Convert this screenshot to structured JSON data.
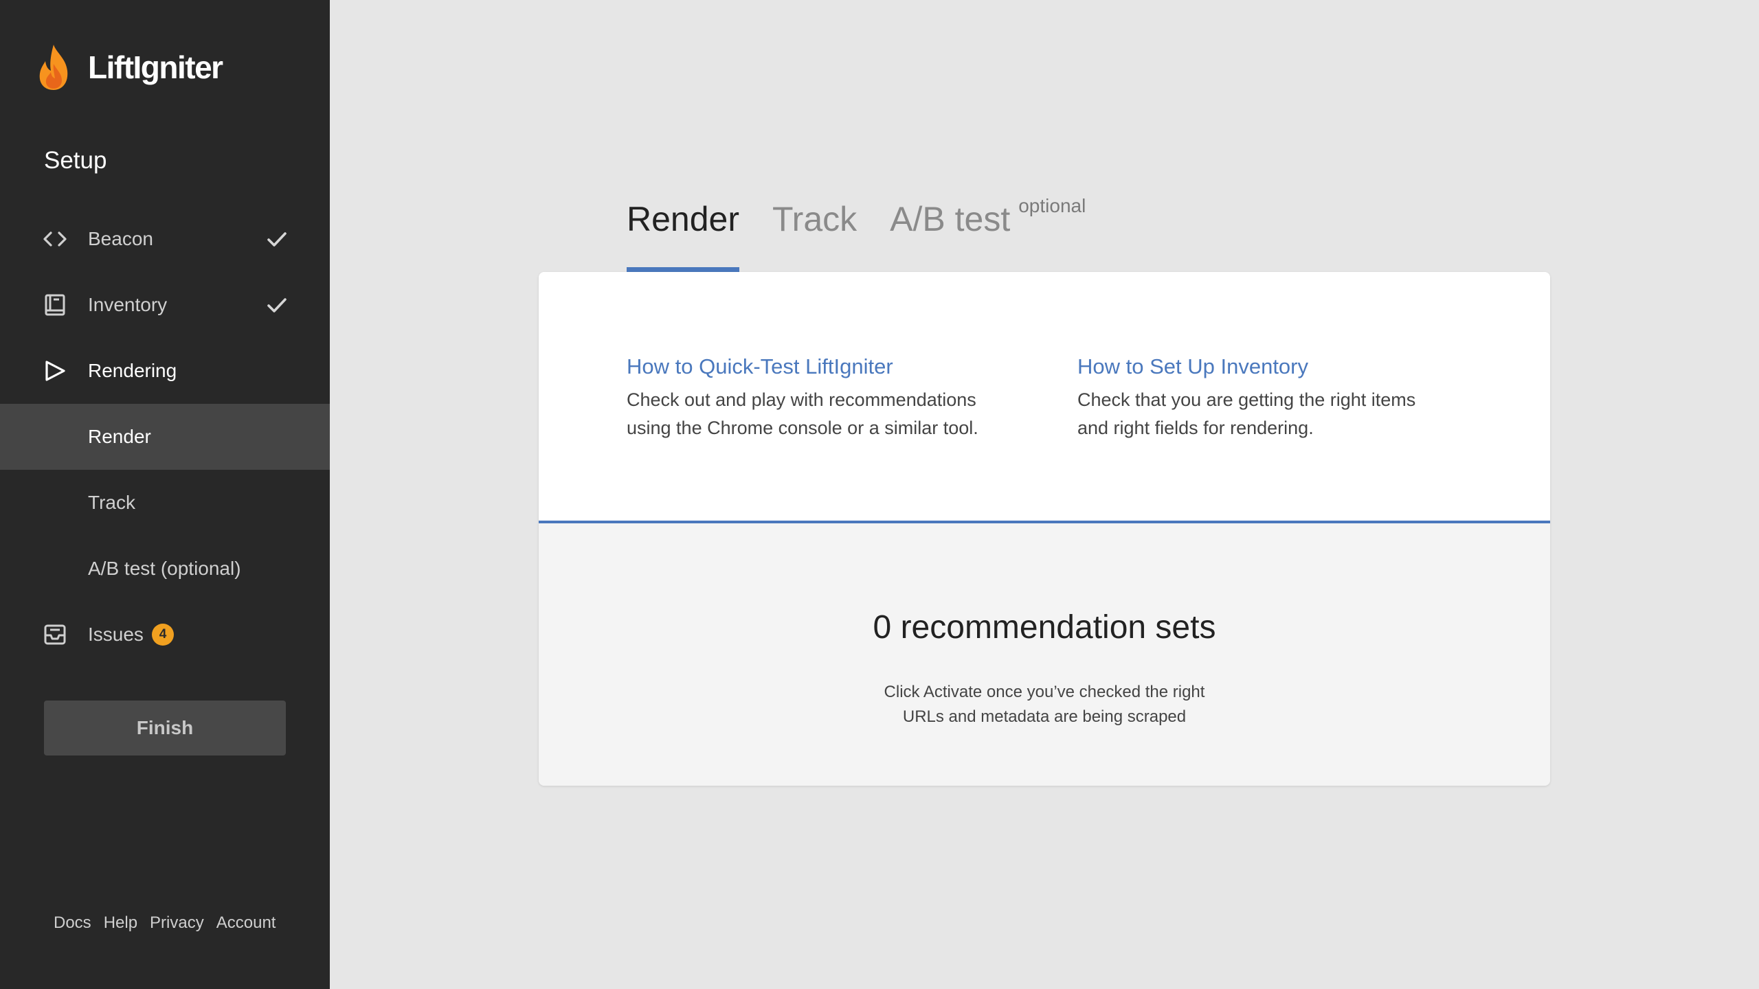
{
  "brand": {
    "name": "LiftIgniter",
    "flame_color": "#f7931e"
  },
  "sidebar": {
    "section_title": "Setup",
    "items": [
      {
        "label": "Beacon",
        "icon": "code-brackets-icon",
        "completed": true
      },
      {
        "label": "Inventory",
        "icon": "book-icon",
        "completed": true
      },
      {
        "label": "Rendering",
        "icon": "play-outline-icon",
        "completed": false,
        "active": true
      },
      {
        "label": "Render",
        "selected": true
      },
      {
        "label": "Track"
      },
      {
        "label": "A/B test (optional)"
      },
      {
        "label": "Issues",
        "icon": "inbox-icon",
        "badge": "4"
      }
    ],
    "finish_label": "Finish",
    "footer_links": [
      "Docs",
      "Help",
      "Privacy",
      "Account"
    ]
  },
  "main": {
    "tabs": [
      {
        "label": "Render",
        "active": true
      },
      {
        "label": "Track"
      },
      {
        "label": "A/B test",
        "suffix": "optional"
      }
    ],
    "help": [
      {
        "title": "How to Quick-Test LiftIgniter",
        "desc_line1": "Check out and play with recommendations",
        "desc_line2": "using the Chrome console or a similar tool."
      },
      {
        "title": "How to Set Up Inventory",
        "desc_line1": "Check that you are getting the right items",
        "desc_line2": "and right fields for rendering."
      }
    ],
    "count_title": "0 recommendation sets",
    "instruction_line1": "Click Activate once you’ve checked the right",
    "instruction_line2": "URLs and metadata are being scraped"
  },
  "colors": {
    "accent": "#4a78bd",
    "sidebar_bg": "#282828",
    "selected_bg": "#454545",
    "badge": "#f0a020",
    "page_bg": "#e6e6e6"
  }
}
